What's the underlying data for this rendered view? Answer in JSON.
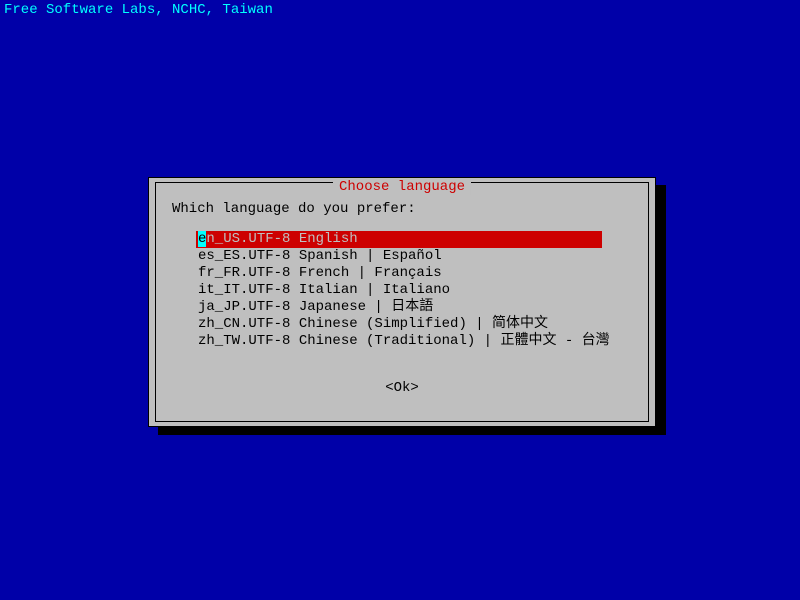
{
  "header": "Free Software Labs, NCHC, Taiwan",
  "dialog": {
    "title": "Choose language",
    "prompt": "Which language do you prefer:",
    "ok_label": "<Ok>"
  },
  "languages": {
    "items": [
      {
        "label": "en_US.UTF-8 English",
        "selected": true
      },
      {
        "label": "es_ES.UTF-8 Spanish | Español",
        "selected": false
      },
      {
        "label": "fr_FR.UTF-8 French | Français",
        "selected": false
      },
      {
        "label": "it_IT.UTF-8 Italian | Italiano",
        "selected": false
      },
      {
        "label": "ja_JP.UTF-8 Japanese | 日本語",
        "selected": false
      },
      {
        "label": "zh_CN.UTF-8 Chinese (Simplified) | 简体中文",
        "selected": false
      },
      {
        "label": "zh_TW.UTF-8 Chinese (Traditional) | 正體中文 - 台灣",
        "selected": false
      }
    ]
  }
}
